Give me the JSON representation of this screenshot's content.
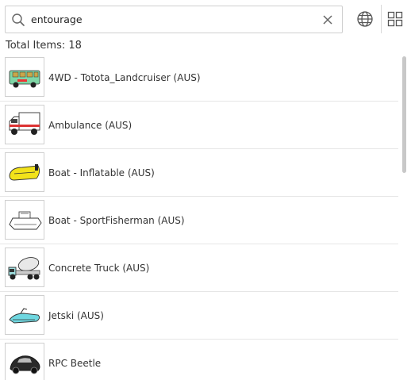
{
  "search": {
    "value": "entourage",
    "placeholder": "Search"
  },
  "toolbar": {
    "globe_icon": "globe-icon",
    "grid_icon": "grid-view-icon"
  },
  "summary": {
    "total_label": "Total Items: 18"
  },
  "items": [
    {
      "label": "4WD - Totota_Landcruiser (AUS)",
      "icon": "landcruiser-thumbnail",
      "color": "#7fd6a6"
    },
    {
      "label": "Ambulance (AUS)",
      "icon": "ambulance-thumbnail",
      "color": "#ffffff"
    },
    {
      "label": "Boat - Inflatable (AUS)",
      "icon": "inflatable-boat-thumbnail",
      "color": "#f2e21a"
    },
    {
      "label": "Boat - SportFisherman (AUS)",
      "icon": "sport-fisherman-boat-thumbnail",
      "color": "#ffffff"
    },
    {
      "label": "Concrete Truck (AUS)",
      "icon": "concrete-truck-thumbnail",
      "color": "#9edede"
    },
    {
      "label": "Jetski (AUS)",
      "icon": "jetski-thumbnail",
      "color": "#6fd7e0"
    },
    {
      "label": "RPC Beetle",
      "icon": "beetle-car-thumbnail",
      "color": "#222222"
    }
  ]
}
